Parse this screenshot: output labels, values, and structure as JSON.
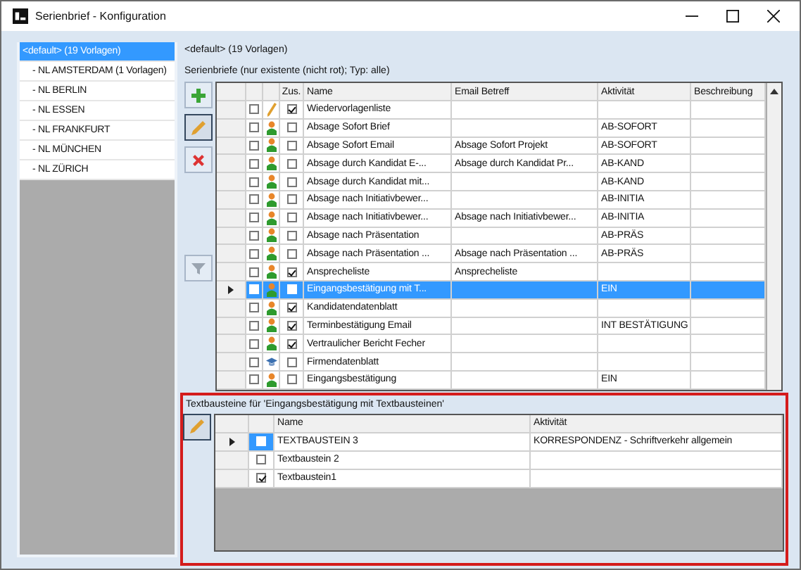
{
  "window": {
    "title": "Serienbrief - Konfiguration"
  },
  "groups": [
    {
      "label": "<default> (19 Vorlagen)",
      "selected": true
    },
    {
      "label": "- NL AMSTERDAM (1 Vorlagen)",
      "selected": false
    },
    {
      "label": "- NL BERLIN",
      "selected": false
    },
    {
      "label": "- NL ESSEN",
      "selected": false
    },
    {
      "label": "- NL FRANKFURT",
      "selected": false
    },
    {
      "label": "- NL MÜNCHEN",
      "selected": false
    },
    {
      "label": "- NL ZÜRICH",
      "selected": false
    }
  ],
  "heading": "<default> (19 Vorlagen)",
  "letters": {
    "caption": "Serienbriefe (nur existente (nicht rot); Typ: alle)",
    "columns": [
      "Zus.",
      "Name",
      "Email Betreff",
      "Aktivität",
      "Beschreibung"
    ],
    "rows": [
      {
        "selected": false,
        "checked": false,
        "kind": "pencil",
        "zus": true,
        "name": "Wiedervorlagenliste"
      },
      {
        "selected": false,
        "checked": false,
        "kind": "person",
        "zus": false,
        "name": "Absage Sofort Brief",
        "activity": "AB-SOFORT"
      },
      {
        "selected": false,
        "checked": false,
        "kind": "person",
        "zus": false,
        "name": "Absage Sofort Email",
        "email": "Absage Sofort Projekt",
        "activity": "AB-SOFORT"
      },
      {
        "selected": false,
        "checked": false,
        "kind": "person",
        "zus": false,
        "name": "Absage durch Kandidat E-...",
        "email": "Absage durch Kandidat Pr...",
        "activity": "AB-KAND"
      },
      {
        "selected": false,
        "checked": false,
        "kind": "person",
        "zus": false,
        "name": "Absage durch Kandidat mit...",
        "activity": "AB-KAND"
      },
      {
        "selected": false,
        "checked": false,
        "kind": "person",
        "zus": false,
        "name": "Absage nach Initiativbewer...",
        "activity": "AB-INITIA"
      },
      {
        "selected": false,
        "checked": false,
        "kind": "person",
        "zus": false,
        "name": "Absage nach Initiativbewer...",
        "email": "Absage nach Initiativbewer...",
        "activity": "AB-INITIA"
      },
      {
        "selected": false,
        "checked": false,
        "kind": "person",
        "zus": false,
        "name": "Absage nach Präsentation",
        "activity": "AB-PRÄS"
      },
      {
        "selected": false,
        "checked": false,
        "kind": "person",
        "zus": false,
        "name": "Absage nach Präsentation ...",
        "email": "Absage nach Präsentation ...",
        "activity": "AB-PRÄS"
      },
      {
        "selected": false,
        "checked": false,
        "kind": "person",
        "zus": true,
        "name": "Ansprecheliste",
        "email": "Ansprecheliste"
      },
      {
        "selected": true,
        "checked": false,
        "kind": "person",
        "zus": false,
        "name": "Eingangsbestätigung mit T...",
        "activity": "EIN"
      },
      {
        "selected": false,
        "checked": false,
        "kind": "person",
        "zus": true,
        "name": "Kandidatendatenblatt"
      },
      {
        "selected": false,
        "checked": false,
        "kind": "person",
        "zus": true,
        "name": "Terminbestätigung Email",
        "activity": "INT BESTÄTIGUNG"
      },
      {
        "selected": false,
        "checked": false,
        "kind": "person",
        "zus": true,
        "name": "Vertraulicher Bericht Fecher"
      },
      {
        "selected": false,
        "checked": false,
        "kind": "hat",
        "zus": false,
        "name": "Firmendatenblatt"
      },
      {
        "selected": false,
        "checked": false,
        "kind": "person",
        "zus": false,
        "name": "Eingangsbestätigung",
        "activity": "EIN"
      }
    ]
  },
  "modules": {
    "caption": "Textbausteine für 'Eingangsbestätigung mit Textbausteinen'",
    "columns": [
      "Name",
      "Aktivität"
    ],
    "rows": [
      {
        "selected": true,
        "checked": false,
        "name": "TEXTBAUSTEIN 3",
        "activity": "KORRESPONDENZ - Schriftverkehr allgemein"
      },
      {
        "selected": false,
        "checked": false,
        "name": "Textbaustein 2"
      },
      {
        "selected": false,
        "checked": true,
        "name": "Textbaustein1"
      }
    ]
  }
}
